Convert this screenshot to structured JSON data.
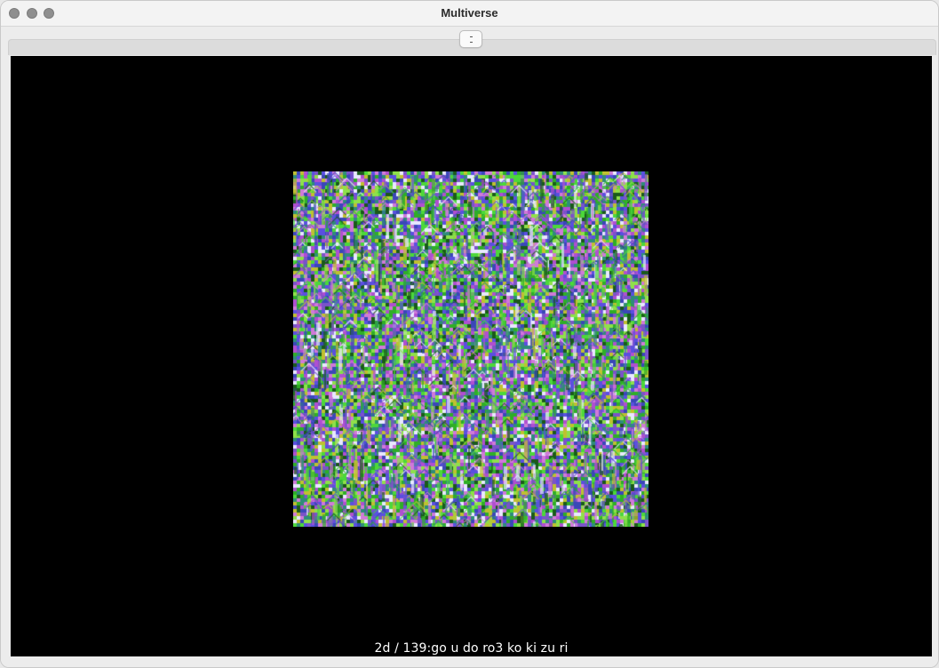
{
  "window": {
    "title": "Multiverse"
  },
  "toolbar": {
    "toggle_icon": "sidebar-toggle-icon"
  },
  "canvas": {
    "palette": [
      "#2fae27",
      "#4cd83a",
      "#7b53c9",
      "#3a47b8",
      "#d07ad8",
      "#8fe04a",
      "#2f8c7a",
      "#c0c030",
      "#5a4fe0",
      "#e8e8ff",
      "#1a5a1a",
      "#b04fd0"
    ]
  },
  "status": {
    "text": "2d / 139:go u do ro3 ko ki zu ri"
  }
}
